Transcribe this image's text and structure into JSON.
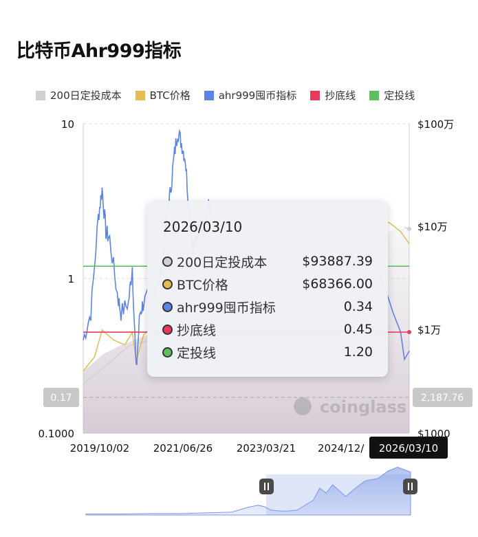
{
  "title": "比特币Ahr999指标",
  "legend": [
    {
      "label": "200日定投成本",
      "color": "#cfd0d2"
    },
    {
      "label": "BTC价格",
      "color": "#e5bb55"
    },
    {
      "label": "ahr999囤币指标",
      "color": "#5b84e6"
    },
    {
      "label": "抄底线",
      "color": "#e83a5c"
    },
    {
      "label": "定投线",
      "color": "#5cc062"
    }
  ],
  "tooltip": {
    "date": "2026/03/10",
    "rows": [
      {
        "label": "200日定投成本",
        "value": "$93887.39",
        "color": "#cfd0d2"
      },
      {
        "label": "BTC价格",
        "value": "$68366.00",
        "color": "#e5bb55"
      },
      {
        "label": "ahr999囤币指标",
        "value": "0.34",
        "color": "#5b84e6"
      },
      {
        "label": "抄底线",
        "value": "0.45",
        "color": "#e83a5c"
      },
      {
        "label": "定投线",
        "value": "1.20",
        "color": "#5cc062"
      }
    ]
  },
  "crosshair": {
    "left_value": "0.17",
    "right_value": "2,187.76"
  },
  "watermark": "coinglass",
  "chart_data": {
    "type": "line",
    "left_axis": {
      "scale": "log",
      "range": [
        0.1,
        10
      ],
      "ticks": [
        "10",
        "1",
        "0.1000"
      ]
    },
    "right_axis": {
      "scale": "log",
      "range": [
        1000,
        1000000
      ],
      "ticks": [
        "$100万",
        "$10万",
        "$1万",
        "$1000"
      ]
    },
    "x_ticks": [
      "2019/10/02",
      "2021/06/26",
      "2023/03/21",
      "2024/12/",
      "2026/03/10"
    ],
    "x_range": [
      "2019/01",
      "2026/03/10"
    ],
    "reference_lines": [
      {
        "name": "抄底线",
        "value": 0.45
      },
      {
        "name": "定投线",
        "value": 1.2
      }
    ],
    "series": [
      {
        "name": "ahr999囤币指标",
        "axis": "left",
        "points": [
          [
            "2019/01",
            0.4
          ],
          [
            "2019/03",
            0.6
          ],
          [
            "2019/05",
            2.5
          ],
          [
            "2019/06",
            3.8
          ],
          [
            "2019/07",
            2.0
          ],
          [
            "2019/08",
            1.8
          ],
          [
            "2019/10",
            0.8
          ],
          [
            "2019/11",
            0.6
          ],
          [
            "2020/01",
            0.7
          ],
          [
            "2020/02",
            1.2
          ],
          [
            "2020/03",
            0.25
          ],
          [
            "2020/04",
            0.6
          ],
          [
            "2020/05",
            0.7
          ],
          [
            "2020/07",
            0.8
          ],
          [
            "2020/09",
            1.0
          ],
          [
            "2020/10",
            1.2
          ],
          [
            "2020/11",
            2.5
          ],
          [
            "2020/12",
            3.5
          ],
          [
            "2021/01",
            6.0
          ],
          [
            "2021/02",
            9.0
          ],
          [
            "2021/03",
            7.5
          ],
          [
            "2021/04",
            6.0
          ],
          [
            "2021/05",
            2.8
          ],
          [
            "2021/06",
            1.6
          ],
          [
            "2021/07",
            1.7
          ],
          [
            "2021/08",
            2.4
          ],
          [
            "2021/09",
            2.0
          ],
          [
            "2021/10",
            3.0
          ],
          [
            "2021/11",
            2.5
          ]
        ]
      },
      {
        "name": "BTC价格",
        "axis": "right",
        "points": [
          [
            "2019/01",
            4000
          ],
          [
            "2019/04",
            5500
          ],
          [
            "2019/06",
            10000
          ],
          [
            "2019/09",
            8000
          ],
          [
            "2019/12",
            7200
          ],
          [
            "2020/02",
            9500
          ],
          [
            "2020/03",
            5000
          ],
          [
            "2020/05",
            9000
          ],
          [
            "2020/08",
            11500
          ],
          [
            "2020/10",
            11000
          ],
          [
            "2025/04",
            88000
          ],
          [
            "2025/07",
            115000
          ],
          [
            "2025/10",
            110000
          ],
          [
            "2026/01",
            90000
          ],
          [
            "2026/03/10",
            68366
          ]
        ]
      },
      {
        "name": "200日定投成本",
        "axis": "right",
        "points": [
          [
            "2019/01",
            3000
          ],
          [
            "2019/07",
            4500
          ],
          [
            "2020/01",
            7000
          ],
          [
            "2020/07",
            8000
          ],
          [
            "2020/12",
            10500
          ],
          [
            "2026/02",
            100000
          ],
          [
            "2026/03/10",
            93887
          ]
        ]
      }
    ],
    "navigator": {
      "selected_range": [
        "2023/03",
        "2026/03/10"
      ]
    }
  }
}
